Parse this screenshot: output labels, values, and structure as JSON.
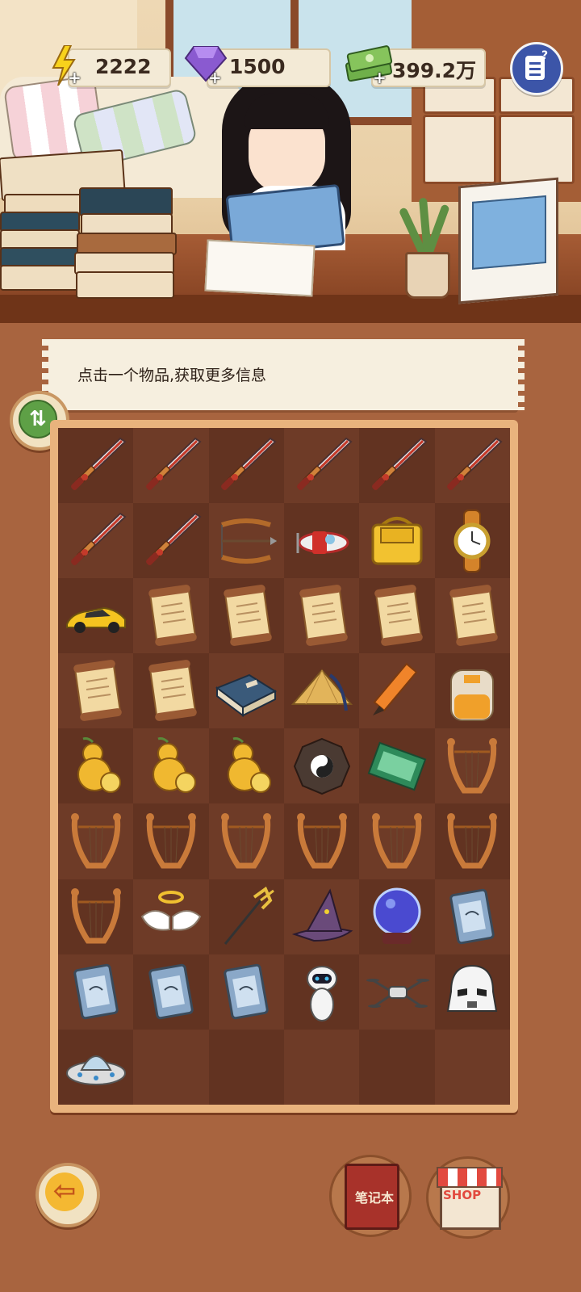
{
  "hud": {
    "energy": "2222",
    "gems": "1500",
    "cash": "399.2万",
    "plus": "+"
  },
  "info": {
    "text": "点击一个物品,获取更多信息"
  },
  "buttons": {
    "notebook_label": "笔记本",
    "shop_label": "SHOP",
    "sort_glyph": "⇅",
    "back_glyph": "⇦"
  },
  "grid": {
    "columns": 6,
    "rows": 9,
    "items": [
      "sword",
      "sword",
      "sword",
      "sword",
      "sword",
      "sword",
      "sword",
      "sword",
      "crossbow",
      "toy-airplane",
      "handbag",
      "wristwatch",
      "sports-car",
      "scroll",
      "scroll",
      "scroll",
      "scroll",
      "scroll",
      "scroll",
      "scroll",
      "ancient-book",
      "bamboo-hat",
      "pencil",
      "backpack",
      "gourd",
      "gourd",
      "gourd",
      "bagua-compass",
      "green-ticket",
      "lyre",
      "lyre",
      "lyre",
      "lyre",
      "lyre",
      "lyre",
      "lyre",
      "lyre",
      "angel-halo-wings",
      "trident",
      "wizard-hat",
      "crystal-ball",
      "circuit-chip",
      "circuit-chip",
      "circuit-chip",
      "circuit-chip",
      "robot-eve",
      "drone",
      "stormtrooper-helmet",
      "ufo",
      "",
      "",
      "",
      "",
      ""
    ]
  },
  "colors": {
    "background": "#a8643f",
    "cell_dark": "#623321",
    "cell_light": "#6e3b27",
    "board_border": "#e9b37d"
  }
}
